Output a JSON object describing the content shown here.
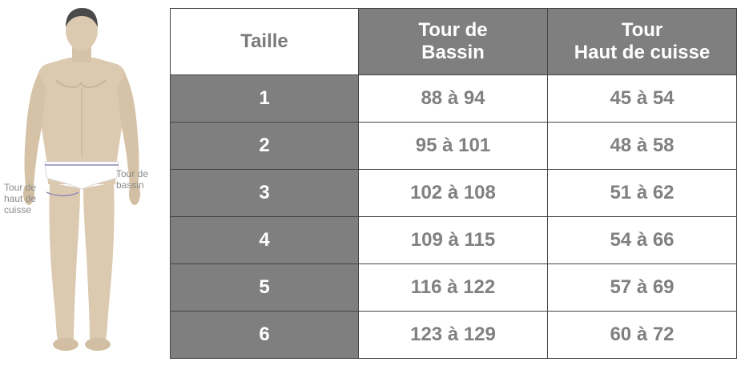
{
  "figure": {
    "hip_label": "Tour de bassin",
    "thigh_label": "Tour de haut de cuisse"
  },
  "table": {
    "headers": {
      "size": "Taille",
      "hip_line1": "Tour de",
      "hip_line2": "Bassin",
      "thigh_line1": "Tour",
      "thigh_line2": "Haut de cuisse"
    },
    "rows": [
      {
        "size": "1",
        "hip": "88 à 94",
        "thigh": "45 à 54"
      },
      {
        "size": "2",
        "hip": "95 à 101",
        "thigh": "48 à 58"
      },
      {
        "size": "3",
        "hip": "102 à 108",
        "thigh": "51 à 62"
      },
      {
        "size": "4",
        "hip": "109 à 115",
        "thigh": "54 à 66"
      },
      {
        "size": "5",
        "hip": "116 à 122",
        "thigh": "57 à 69"
      },
      {
        "size": "6",
        "hip": "123 à 129",
        "thigh": "60 à 72"
      }
    ]
  },
  "colors": {
    "header_dark": "#7f7f7f",
    "text_gray": "#808080",
    "skin": "#dccab0",
    "hair": "#4a4a4a",
    "briefs": "#ffffff",
    "measure_line": "#8f86b8"
  }
}
